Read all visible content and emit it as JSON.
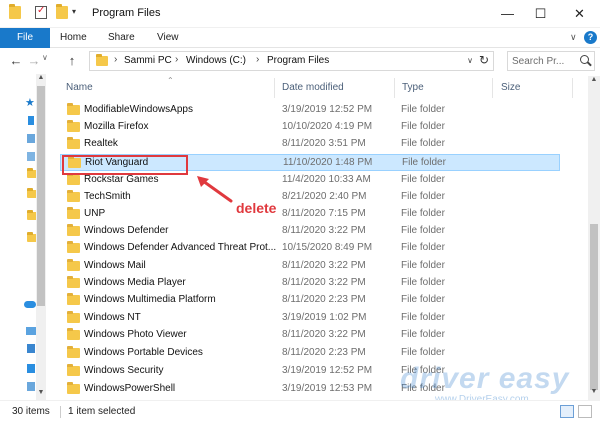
{
  "window": {
    "title": "Program Files",
    "minimize_glyph": "—",
    "maximize_glyph": "☐",
    "close_glyph": "✕"
  },
  "quick_access": {
    "dropdown_glyph": "▾"
  },
  "ribbon": {
    "file_label": "File",
    "tabs": [
      "Home",
      "Share",
      "View"
    ],
    "expand_glyph": "∨",
    "help_glyph": "?"
  },
  "address": {
    "back_glyph": "←",
    "forward_glyph": "→",
    "recent_glyph": "∨",
    "up_glyph": "↑",
    "breadcrumbs": [
      "Sammi PC",
      "Windows (C:)",
      "Program Files"
    ],
    "separator_glyph": "›",
    "dropdown_glyph": "∨",
    "refresh_glyph": "↻"
  },
  "search": {
    "placeholder": "Search Pr..."
  },
  "columns": {
    "name": "Name",
    "date": "Date modified",
    "type": "Type",
    "size": "Size"
  },
  "files": [
    {
      "name": "ModifiableWindowsApps",
      "date": "3/19/2019 12:52 PM",
      "type": "File folder"
    },
    {
      "name": "Mozilla Firefox",
      "date": "10/10/2020 4:19 PM",
      "type": "File folder"
    },
    {
      "name": "Realtek",
      "date": "8/11/2020 3:51 PM",
      "type": "File folder"
    },
    {
      "name": "Riot Vanguard",
      "date": "11/10/2020 1:48 PM",
      "type": "File folder",
      "selected": true
    },
    {
      "name": "Rockstar Games",
      "date": "11/4/2020 10:33 AM",
      "type": "File folder"
    },
    {
      "name": "TechSmith",
      "date": "8/21/2020 2:40 PM",
      "type": "File folder"
    },
    {
      "name": "UNP",
      "date": "8/11/2020 7:15 PM",
      "type": "File folder"
    },
    {
      "name": "Windows Defender",
      "date": "8/11/2020 3:22 PM",
      "type": "File folder"
    },
    {
      "name": "Windows Defender Advanced Threat Prot...",
      "date": "10/15/2020 8:49 PM",
      "type": "File folder"
    },
    {
      "name": "Windows Mail",
      "date": "8/11/2020 3:22 PM",
      "type": "File folder"
    },
    {
      "name": "Windows Media Player",
      "date": "8/11/2020 3:22 PM",
      "type": "File folder"
    },
    {
      "name": "Windows Multimedia Platform",
      "date": "8/11/2020 2:23 PM",
      "type": "File folder"
    },
    {
      "name": "Windows NT",
      "date": "3/19/2019 1:02 PM",
      "type": "File folder"
    },
    {
      "name": "Windows Photo Viewer",
      "date": "8/11/2020 3:22 PM",
      "type": "File folder"
    },
    {
      "name": "Windows Portable Devices",
      "date": "8/11/2020 2:23 PM",
      "type": "File folder"
    },
    {
      "name": "Windows Security",
      "date": "3/19/2019 12:52 PM",
      "type": "File folder"
    },
    {
      "name": "WindowsPowerShell",
      "date": "3/19/2019 12:53 PM",
      "type": "File folder"
    }
  ],
  "annotation": {
    "label": "delete",
    "color": "#e0393e"
  },
  "watermark": {
    "text": "driver easy",
    "url": "www.DriverEasy.com"
  },
  "status": {
    "count": "30 items",
    "selection": "1 item selected"
  },
  "colors": {
    "accent": "#1979ca",
    "selection_bg": "#cce8ff",
    "folder": "#f5c84a"
  }
}
